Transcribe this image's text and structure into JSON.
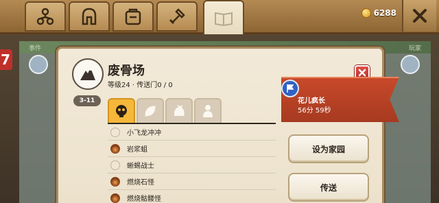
{
  "topbar": {
    "tabs": [
      {
        "name": "tab-skilltree",
        "icon": "skill-tree-icon"
      },
      {
        "name": "tab-armory",
        "icon": "helmet-icon"
      },
      {
        "name": "tab-inventory",
        "icon": "backpack-icon"
      },
      {
        "name": "tab-crafting",
        "icon": "hammer-icon"
      },
      {
        "name": "tab-map",
        "icon": "map-book-icon",
        "active": true
      }
    ],
    "coins": "6288"
  },
  "background": {
    "left_label": "事件",
    "right_label": "玩家",
    "badge": "7"
  },
  "location": {
    "title": "废骨场",
    "subtitle": "等级24 · 传送门0 / 0",
    "level_range": "3-11"
  },
  "categories": [
    {
      "name": "cat-monster",
      "icon": "skull-icon",
      "active": true
    },
    {
      "name": "cat-plant",
      "icon": "leaf-icon",
      "active": false
    },
    {
      "name": "cat-beast",
      "icon": "beast-icon",
      "active": false
    },
    {
      "name": "cat-human",
      "icon": "person-icon",
      "active": false
    }
  ],
  "creatures": [
    {
      "name": "小飞龙冲冲",
      "icon": "empty"
    },
    {
      "name": "岩浆蛆",
      "icon": "fire"
    },
    {
      "name": "蜥蜴战士",
      "icon": "empty"
    },
    {
      "name": "燃烧石怪",
      "icon": "fire"
    },
    {
      "name": "燃烧骷髅怪",
      "icon": "fire"
    }
  ],
  "event": {
    "title": "花儿疯长",
    "time": "56分 59秒"
  },
  "buttons": {
    "set_home": "设为家园",
    "teleport": "传送"
  },
  "colors": {
    "accent_orange": "#f6b83a",
    "ribbon_red": "#c8492a",
    "close_red": "#e0524a"
  }
}
